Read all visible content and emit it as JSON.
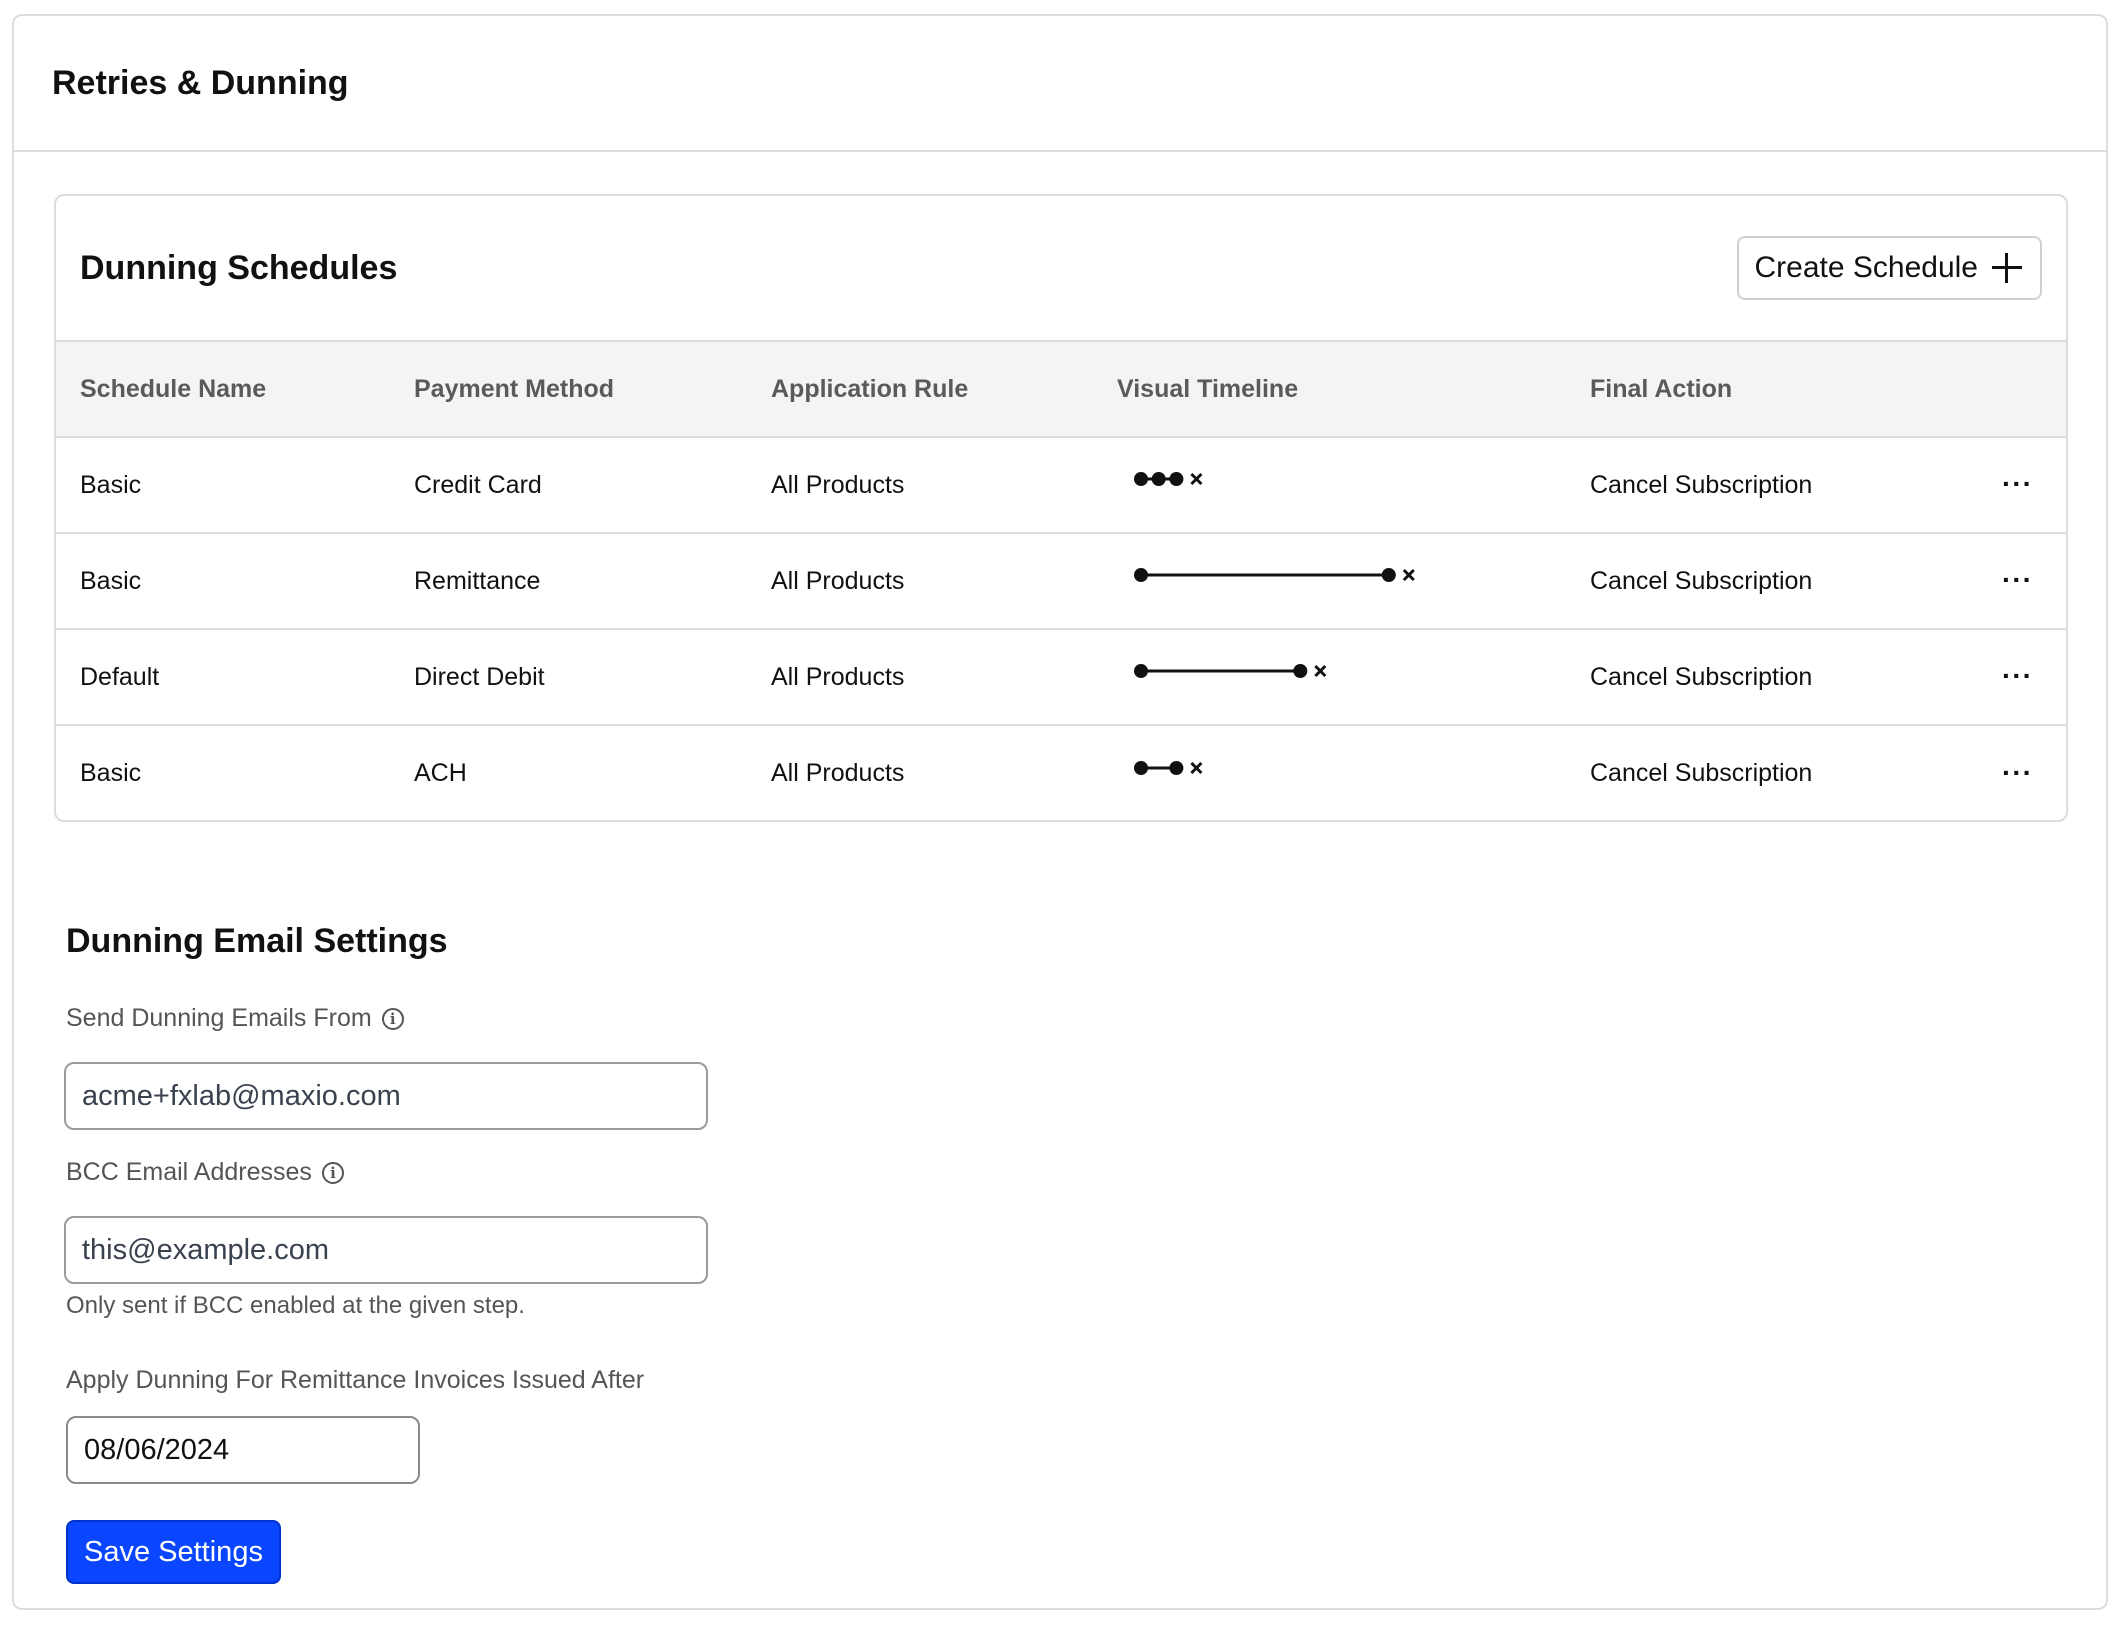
{
  "page": {
    "title": "Retries & Dunning"
  },
  "schedules": {
    "title": "Dunning Schedules",
    "create_button": "Create Schedule",
    "columns": {
      "name": "Schedule Name",
      "method": "Payment Method",
      "rule": "Application Rule",
      "timeline": "Visual Timeline",
      "action": "Final Action"
    },
    "rows": [
      {
        "name": "Basic",
        "method": "Credit Card",
        "rule": "All Products",
        "action": "Cancel Subscription",
        "more": "···",
        "timeline_days": [
          0,
          1,
          2
        ]
      },
      {
        "name": "Basic",
        "method": "Remittance",
        "rule": "All Products",
        "action": "Cancel Subscription",
        "more": "···",
        "timeline_days": [
          0,
          14
        ]
      },
      {
        "name": "Default",
        "method": "Direct Debit",
        "rule": "All Products",
        "action": "Cancel Subscription",
        "more": "···",
        "timeline_days": [
          0,
          9
        ]
      },
      {
        "name": "Basic",
        "method": "ACH",
        "rule": "All Products",
        "action": "Cancel Subscription",
        "more": "···",
        "timeline_days": [
          0,
          2
        ]
      }
    ]
  },
  "email_settings": {
    "title": "Dunning Email Settings",
    "from_label": "Send Dunning Emails From",
    "from_value": "acme+fxlab@maxio.com",
    "bcc_label": "BCC Email Addresses",
    "bcc_value": "this@example.com",
    "bcc_helper": "Only sent if BCC enabled at the given step.",
    "apply_after_label": "Apply Dunning For Remittance Invoices Issued After",
    "apply_after_value": "08/06/2024",
    "save_button": "Save Settings"
  },
  "colors": {
    "primary": "#0a46ff",
    "border": "#dcdcdc",
    "header_bg": "#f4f4f4"
  }
}
